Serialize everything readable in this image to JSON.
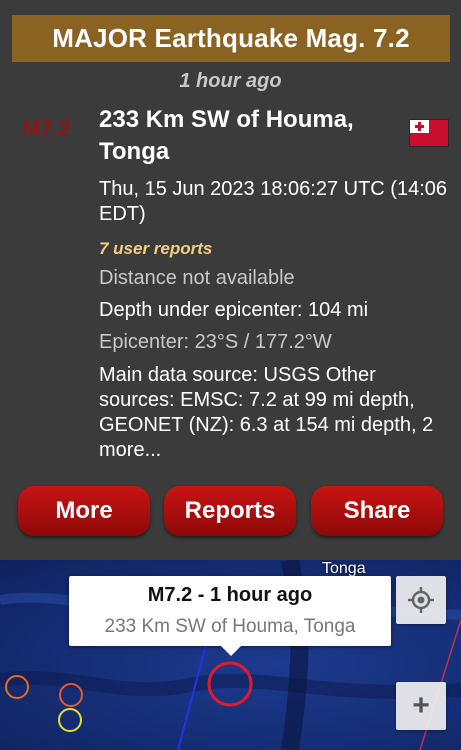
{
  "header": {
    "title": "MAJOR Earthquake Mag. 7.2",
    "time_ago": "1 hour ago"
  },
  "quake": {
    "magnitude": "M7.2",
    "place": "233 Km SW of Houma, Tonga",
    "datetime": "Thu, 15 Jun 2023 18:06:27 UTC (14:06 EDT)",
    "user_reports": "7 user reports",
    "distance": "Distance not available",
    "depth": "Depth under epicenter: 104 mi",
    "epicenter": "Epicenter: 23°S / 177.2°W",
    "sources": "Main data source: USGS Other sources: EMSC: 7.2 at 99 mi depth, GEONET (NZ): 6.3 at 154 mi depth, 2 more...",
    "flag": "tonga-flag"
  },
  "buttons": {
    "more": "More",
    "reports": "Reports",
    "share": "Share"
  },
  "map": {
    "region_label": "Tonga",
    "popup_title": "M7.2  -  1 hour ago",
    "popup_subtitle": "233 Km SW of Houma, Tonga",
    "locate_icon": "crosshair-icon",
    "zoom_in_label": "+"
  },
  "colors": {
    "title_bar": "#8a6323",
    "magnitude": "#8b1616",
    "reports_text": "#f3d080",
    "button": "#b50e0e",
    "panel": "#3b3b3b"
  }
}
